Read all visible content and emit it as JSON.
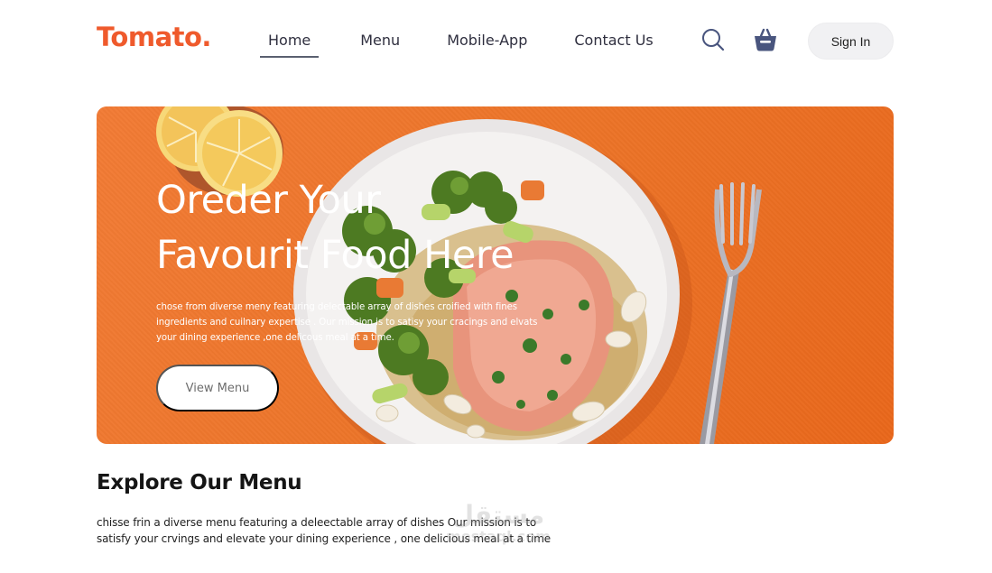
{
  "header": {
    "logo": "Tomato.",
    "nav": [
      "Home",
      "Menu",
      "Mobile-App",
      "Contact Us"
    ],
    "active_nav": "Home",
    "signin_label": "Sign In"
  },
  "hero": {
    "title_line1": "Oreder Your",
    "title_line2": "Favourit Food Here",
    "description": "chose from diverse meny featuring delectable array of dishes croified with fines ingredients and cuilnary expertise . Our mission is to satisy your cracings and elvats your dining experience ,one delicous meal at a time.",
    "button_label": "View Menu"
  },
  "explore": {
    "title": "Explore Our Menu",
    "description": "chisse frin a diverse menu featuring a deleectable array of dishes Our mission is to satisfy your crvings and elevate your dining experience , one delicious meal at a time"
  },
  "watermark": {
    "arabic": "مستقل",
    "latin": "mostaql.com"
  },
  "icons": [
    "search-icon",
    "basket-icon"
  ],
  "colors": {
    "brand": "#ef5a2c",
    "hero_bg": "#ec7428",
    "nav_text": "#2f2f3f",
    "basket_icon": "#49557e"
  }
}
